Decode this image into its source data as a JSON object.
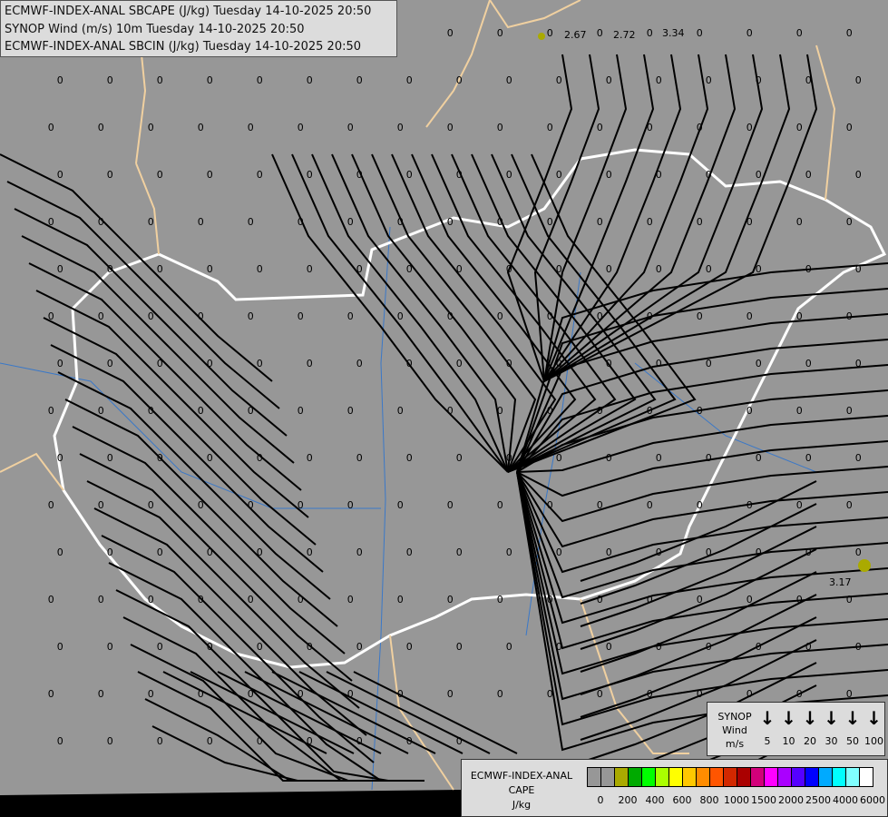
{
  "header": {
    "lines": [
      "ECMWF-INDEX-ANAL SBCAPE (J/kg) Tuesday 14-10-2025 20:50",
      "SYNOP Wind (m/s) 10m Tuesday 14-10-2025 20:50",
      "ECMWF-INDEX-ANAL SBCIN (J/kg) Tuesday 14-10-2025 20:50"
    ]
  },
  "map": {
    "background_color": "#979797",
    "streamline_color": "#000000",
    "country_border_color": "#ffffff",
    "other_border_color": "#f0d0a0",
    "river_color": "#3a78c8",
    "zero_label": "0",
    "cape_labels": [
      "2.67",
      "2.72",
      "3.34",
      "3.17"
    ]
  },
  "synop_legend": {
    "title": [
      "SYNOP",
      "Wind",
      "m/s"
    ],
    "speeds": [
      "5",
      "10",
      "20",
      "30",
      "50",
      "100"
    ],
    "arrow_icon": "arrow-down-icon"
  },
  "cape_legend": {
    "title": [
      "ECMWF-INDEX-ANAL",
      "CAPE",
      "J/kg"
    ],
    "colors": [
      "#979797",
      "#979797",
      "#aaaa00",
      "#00aa00",
      "#00ff00",
      "#aaff00",
      "#ffff00",
      "#ffc800",
      "#ff8c00",
      "#ff5500",
      "#d22800",
      "#aa0000",
      "#d2007a",
      "#ff00ff",
      "#aa00ff",
      "#5500ff",
      "#0000ff",
      "#00aaff",
      "#00ffff",
      "#80ffff",
      "#ffffff"
    ],
    "ticks": [
      "0",
      "200",
      "400",
      "600",
      "800",
      "1000",
      "1500",
      "2000",
      "2500",
      "4000",
      "6000"
    ]
  }
}
